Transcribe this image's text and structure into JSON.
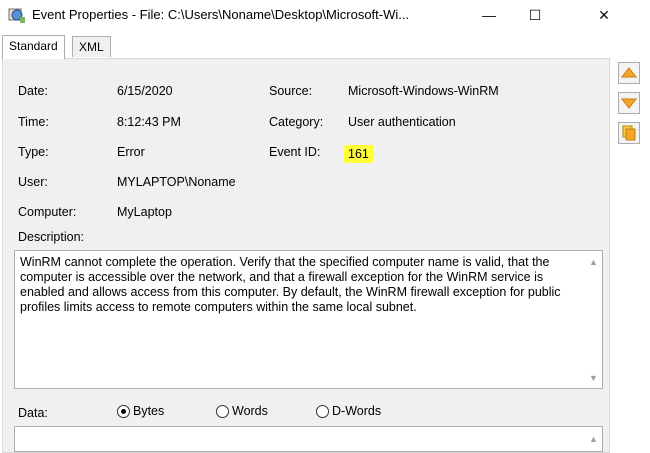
{
  "window": {
    "title": "Event Properties - File: C:\\Users\\Noname\\Desktop\\Microsoft-Wi...",
    "app_icon": "event-viewer-icon",
    "minimize_glyph": "—",
    "maximize_glyph": "☐",
    "close_glyph": "✕"
  },
  "tabs": [
    {
      "label": "Standard",
      "active": true
    },
    {
      "label": "XML",
      "active": false
    }
  ],
  "fields": {
    "date_label": "Date:",
    "date_value": "6/15/2020",
    "time_label": "Time:",
    "time_value": "8:12:43 PM",
    "type_label": "Type:",
    "type_value": "Error",
    "user_label": "User:",
    "user_value": "MYLAPTOP\\Noname",
    "computer_label": "Computer:",
    "computer_value": "MyLaptop",
    "source_label": "Source:",
    "source_value": "Microsoft-Windows-WinRM",
    "category_label": "Category:",
    "category_value": "User authentication",
    "eventid_label": "Event ID:",
    "eventid_value": "161"
  },
  "description": {
    "label": "Description:",
    "text": "WinRM cannot complete the operation. Verify that the specified computer name is valid, that the computer is accessible over the network, and that a firewall exception for the WinRM service is enabled and allows access from this computer. By default, the WinRM firewall exception for public profiles limits access to remote computers within the same local subnet."
  },
  "data": {
    "label": "Data:",
    "options": [
      "Bytes",
      "Words",
      "D-Words"
    ],
    "selected": "Bytes"
  },
  "side_buttons": [
    "up-arrow-icon",
    "down-arrow-icon",
    "copy-icon"
  ],
  "colors": {
    "highlight": "#ffff3a",
    "nav_arrow": "#f5a623"
  }
}
